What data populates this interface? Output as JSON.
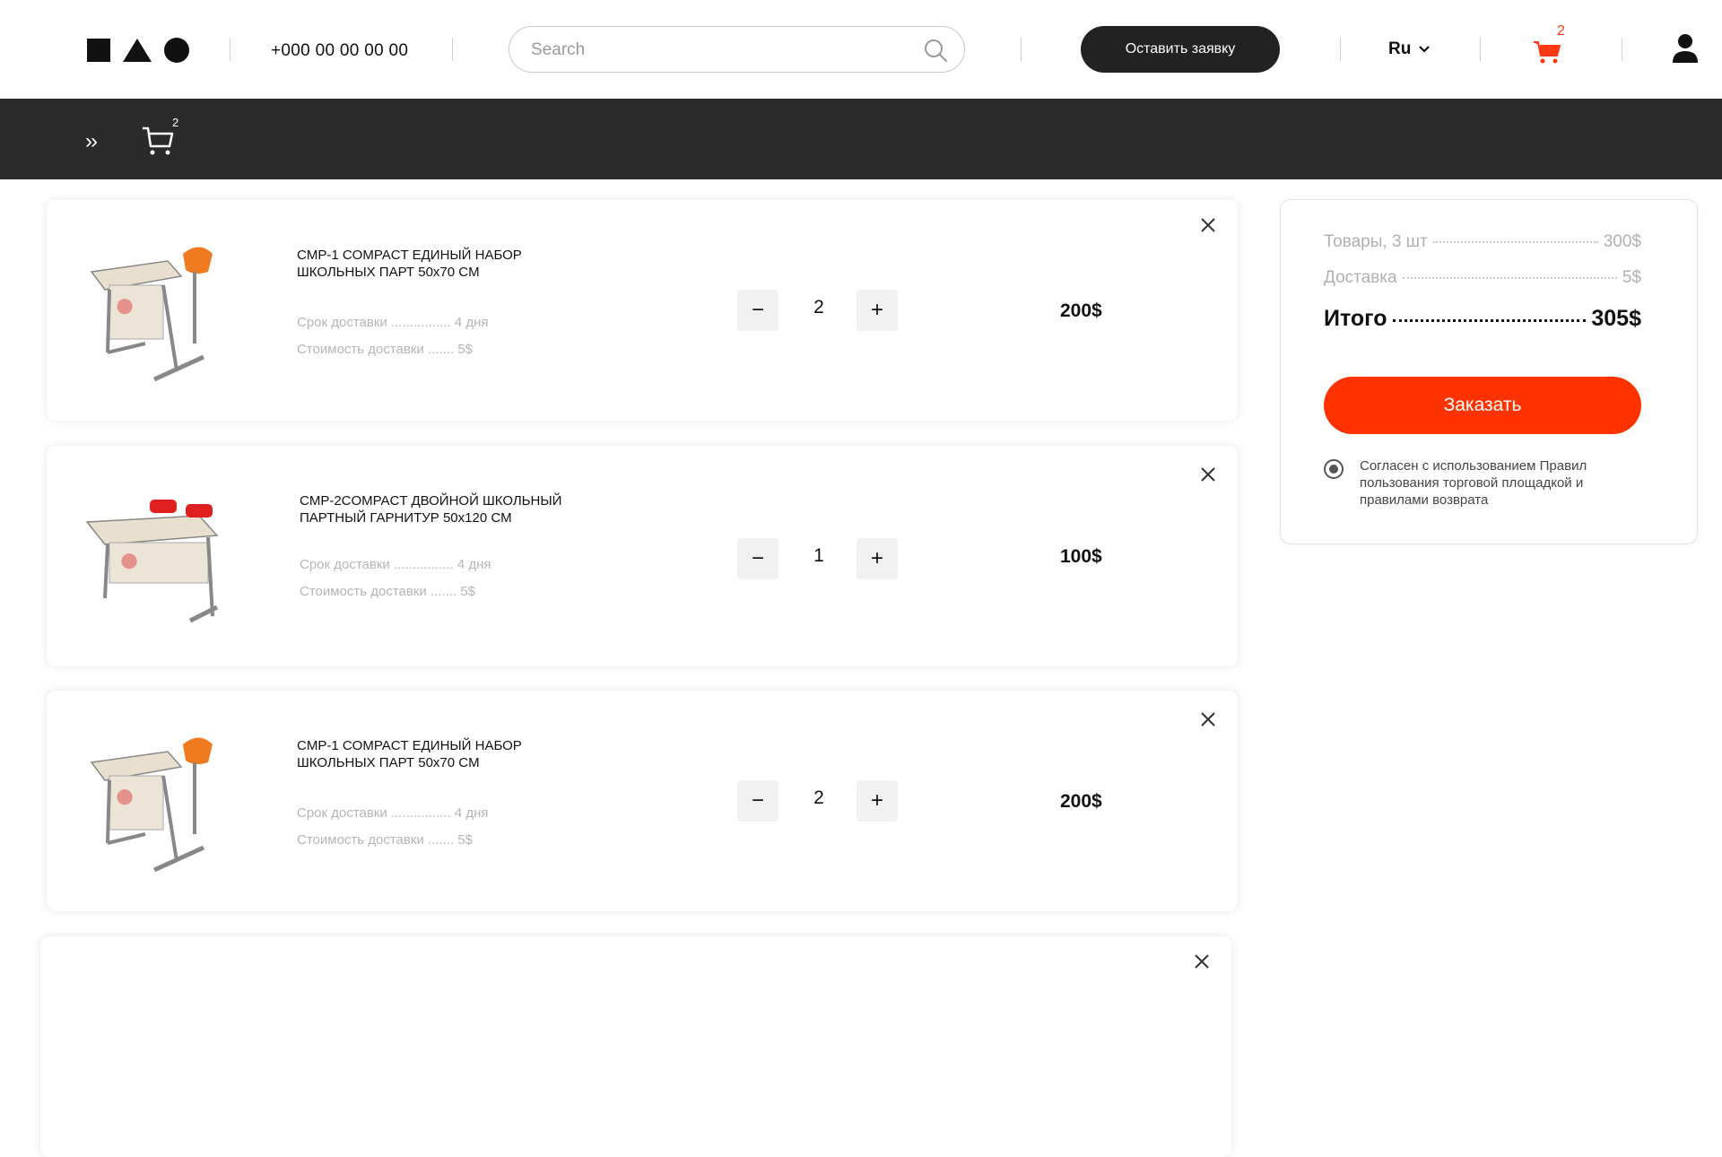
{
  "header": {
    "phone": "+000 00 00 00 00",
    "search_placeholder": "Search",
    "cta_label": "Оставить заявку",
    "language": "Ru",
    "cart_count": "2"
  },
  "subbar": {
    "breadcrumb_icon": "double-chevron",
    "cart_count": "2"
  },
  "cart_items": [
    {
      "title": "CMP-1 COMPACT ЕДИНЫЙ НАБОР ШКОЛЬНЫХ ПАРТ 50x70 CM",
      "delivery_time": "Срок доставки ................ 4 дня",
      "delivery_cost": "Стоимость доставки ....... 5$",
      "quantity": "2",
      "price": "200$",
      "image": "single-school-desk"
    },
    {
      "title": "CMP-2COMPACT ДВОЙНОЙ ШКОЛЬНЫЙ ПАРТНЫЙ ГАРНИТУР 50x120 CM",
      "delivery_time": "Срок доставки ................ 4 дня",
      "delivery_cost": "Стоимость доставки ....... 5$",
      "quantity": "1",
      "price": "100$",
      "image": "double-school-desk"
    },
    {
      "title": "CMP-1 COMPACT ЕДИНЫЙ НАБОР ШКОЛЬНЫХ ПАРТ 50x70 CM",
      "delivery_time": "Срок доставки ................ 4 дня",
      "delivery_cost": "Стоимость доставки ....... 5$",
      "quantity": "2",
      "price": "200$",
      "image": "single-school-desk"
    }
  ],
  "summary": {
    "goods_label": "Товары, 3 шт",
    "goods_value": "300$",
    "delivery_label": "Доставка",
    "delivery_value": "5$",
    "total_label": "Итого",
    "total_value": "305$",
    "order_button": "Заказать",
    "agreement": "Согласен с использованием Правил пользования торговой площадкой и правилами возврата"
  },
  "colors": {
    "accent": "#ff3300",
    "dark": "#2b2b2b"
  }
}
